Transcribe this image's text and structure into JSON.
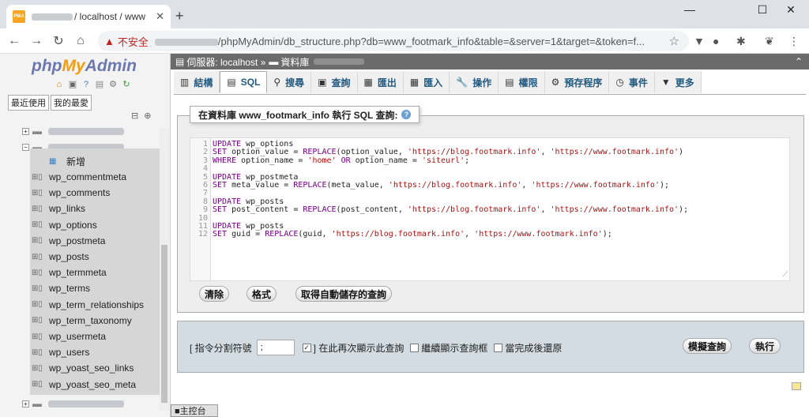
{
  "browser": {
    "tab_title": "/ localhost / www",
    "url": "/phpMyAdmin/db_structure.php?db=www_footmark_info&table=&server=1&target=&token=f...",
    "insecure_label": "不安全",
    "favicon_text": "PMA"
  },
  "nav": {
    "logo_php": "php",
    "logo_my": "My",
    "logo_admin": "Admin",
    "recent": "最近使用",
    "favorites": "我的最愛",
    "new_item": "新增",
    "tables": [
      "wp_commentmeta",
      "wp_comments",
      "wp_links",
      "wp_options",
      "wp_postmeta",
      "wp_posts",
      "wp_termmeta",
      "wp_terms",
      "wp_term_relationships",
      "wp_term_taxonomy",
      "wp_usermeta",
      "wp_users",
      "wp_yoast_seo_links",
      "wp_yoast_seo_meta"
    ]
  },
  "breadcrumb": {
    "server": "伺服器: localhost »",
    "database": "資料庫"
  },
  "tabs": [
    {
      "label": "結構",
      "icon": "structure-icon"
    },
    {
      "label": "SQL",
      "icon": "sql-icon"
    },
    {
      "label": "搜尋",
      "icon": "search-icon"
    },
    {
      "label": "查詢",
      "icon": "query-icon"
    },
    {
      "label": "匯出",
      "icon": "export-icon"
    },
    {
      "label": "匯入",
      "icon": "import-icon"
    },
    {
      "label": "操作",
      "icon": "wrench-icon"
    },
    {
      "label": "權限",
      "icon": "privileges-icon"
    },
    {
      "label": "預存程序",
      "icon": "routines-icon"
    },
    {
      "label": "事件",
      "icon": "clock-icon"
    },
    {
      "label": "更多",
      "icon": "chevron-down-icon"
    }
  ],
  "sql": {
    "legend": "在資料庫 www_footmark_info 執行 SQL 查詢:",
    "lines": [
      "UPDATE wp_options",
      "SET option_value = REPLACE(option_value, 'https://blog.footmark.info', 'https://www.footmark.info')",
      "WHERE option_name = 'home' OR option_name = 'siteurl';",
      "",
      "UPDATE wp_postmeta",
      "SET meta_value = REPLACE(meta_value, 'https://blog.footmark.info', 'https://www.footmark.info');",
      "",
      "UPDATE wp_posts",
      "SET post_content = REPLACE(post_content, 'https://blog.footmark.info', 'https://www.footmark.info');",
      "",
      "UPDATE wp_posts",
      "SET guid = REPLACE(guid, 'https://blog.footmark.info', 'https://www.footmark.info');"
    ],
    "clear": "清除",
    "format": "格式",
    "get_autosaved": "取得自動儲存的查詢"
  },
  "options": {
    "delimiter_label": "[ 指令分割符號",
    "delimiter_value": ";",
    "show_again": "] 在此再次顯示此查詢",
    "retain_box": "繼續顯示查詢框",
    "rollback": "當完成後還原",
    "simulate": "模擬查詢",
    "go": "執行"
  },
  "console": "■主控台"
}
